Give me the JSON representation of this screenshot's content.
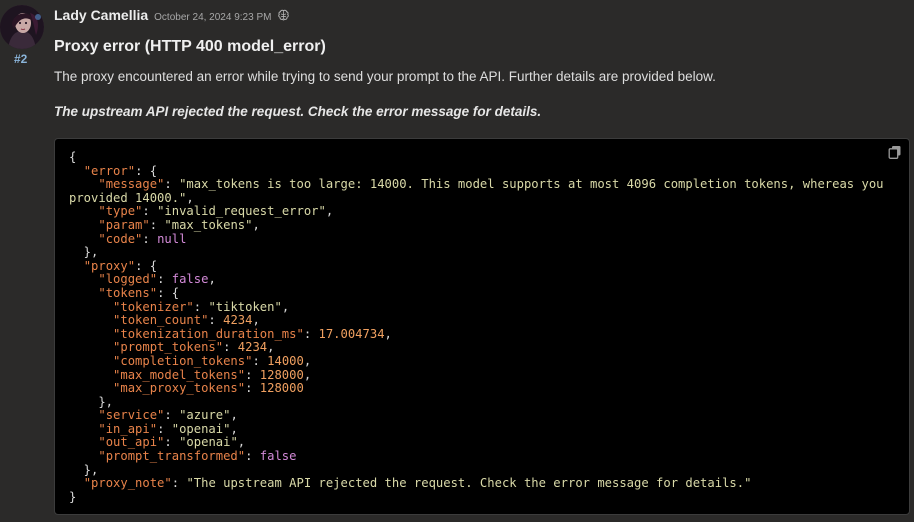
{
  "message": {
    "author": "Lady Camellia",
    "timestamp": "October 24, 2024 9:23 PM",
    "index": "#2",
    "title": "Proxy error (HTTP 400 model_error)",
    "description": "The proxy encountered an error while trying to send your prompt to the API. Further details are provided below.",
    "note": "The upstream API rejected the request. Check the error message for details."
  },
  "icons": {
    "avatar": "avatar-image",
    "brain": "brain-icon",
    "copy": "copy-icon"
  },
  "code": {
    "lines": [
      [
        [
          "p",
          "{"
        ]
      ],
      [
        [
          "p",
          "  "
        ],
        [
          "k",
          "\"error\""
        ],
        [
          "p",
          ": {"
        ]
      ],
      [
        [
          "p",
          "    "
        ],
        [
          "k",
          "\"message\""
        ],
        [
          "p",
          ": "
        ],
        [
          "s",
          "\"max_tokens is too large: 14000. This model supports at most 4096 completion tokens, whereas you"
        ]
      ],
      [
        [
          "s",
          "provided 14000.\""
        ],
        [
          "p",
          ","
        ]
      ],
      [
        [
          "p",
          "    "
        ],
        [
          "k",
          "\"type\""
        ],
        [
          "p",
          ": "
        ],
        [
          "s",
          "\"invalid_request_error\""
        ],
        [
          "p",
          ","
        ]
      ],
      [
        [
          "p",
          "    "
        ],
        [
          "k",
          "\"param\""
        ],
        [
          "p",
          ": "
        ],
        [
          "s",
          "\"max_tokens\""
        ],
        [
          "p",
          ","
        ]
      ],
      [
        [
          "p",
          "    "
        ],
        [
          "k",
          "\"code\""
        ],
        [
          "p",
          ": "
        ],
        [
          "b",
          "null"
        ]
      ],
      [
        [
          "p",
          "  },"
        ]
      ],
      [
        [
          "p",
          "  "
        ],
        [
          "k",
          "\"proxy\""
        ],
        [
          "p",
          ": {"
        ]
      ],
      [
        [
          "p",
          "    "
        ],
        [
          "k",
          "\"logged\""
        ],
        [
          "p",
          ": "
        ],
        [
          "b",
          "false"
        ],
        [
          "p",
          ","
        ]
      ],
      [
        [
          "p",
          "    "
        ],
        [
          "k",
          "\"tokens\""
        ],
        [
          "p",
          ": {"
        ]
      ],
      [
        [
          "p",
          "      "
        ],
        [
          "k",
          "\"tokenizer\""
        ],
        [
          "p",
          ": "
        ],
        [
          "s",
          "\"tiktoken\""
        ],
        [
          "p",
          ","
        ]
      ],
      [
        [
          "p",
          "      "
        ],
        [
          "k",
          "\"token_count\""
        ],
        [
          "p",
          ": "
        ],
        [
          "n",
          "4234"
        ],
        [
          "p",
          ","
        ]
      ],
      [
        [
          "p",
          "      "
        ],
        [
          "k",
          "\"tokenization_duration_ms\""
        ],
        [
          "p",
          ": "
        ],
        [
          "n",
          "17.004734"
        ],
        [
          "p",
          ","
        ]
      ],
      [
        [
          "p",
          "      "
        ],
        [
          "k",
          "\"prompt_tokens\""
        ],
        [
          "p",
          ": "
        ],
        [
          "n",
          "4234"
        ],
        [
          "p",
          ","
        ]
      ],
      [
        [
          "p",
          "      "
        ],
        [
          "k",
          "\"completion_tokens\""
        ],
        [
          "p",
          ": "
        ],
        [
          "n",
          "14000"
        ],
        [
          "p",
          ","
        ]
      ],
      [
        [
          "p",
          "      "
        ],
        [
          "k",
          "\"max_model_tokens\""
        ],
        [
          "p",
          ": "
        ],
        [
          "n",
          "128000"
        ],
        [
          "p",
          ","
        ]
      ],
      [
        [
          "p",
          "      "
        ],
        [
          "k",
          "\"max_proxy_tokens\""
        ],
        [
          "p",
          ": "
        ],
        [
          "n",
          "128000"
        ]
      ],
      [
        [
          "p",
          "    },"
        ]
      ],
      [
        [
          "p",
          "    "
        ],
        [
          "k",
          "\"service\""
        ],
        [
          "p",
          ": "
        ],
        [
          "s",
          "\"azure\""
        ],
        [
          "p",
          ","
        ]
      ],
      [
        [
          "p",
          "    "
        ],
        [
          "k",
          "\"in_api\""
        ],
        [
          "p",
          ": "
        ],
        [
          "s",
          "\"openai\""
        ],
        [
          "p",
          ","
        ]
      ],
      [
        [
          "p",
          "    "
        ],
        [
          "k",
          "\"out_api\""
        ],
        [
          "p",
          ": "
        ],
        [
          "s",
          "\"openai\""
        ],
        [
          "p",
          ","
        ]
      ],
      [
        [
          "p",
          "    "
        ],
        [
          "k",
          "\"prompt_transformed\""
        ],
        [
          "p",
          ": "
        ],
        [
          "b",
          "false"
        ]
      ],
      [
        [
          "p",
          "  },"
        ]
      ],
      [
        [
          "p",
          "  "
        ],
        [
          "k",
          "\"proxy_note\""
        ],
        [
          "p",
          ": "
        ],
        [
          "s",
          "\"The upstream API rejected the request. Check the error message for details.\""
        ]
      ],
      [
        [
          "p",
          "}"
        ]
      ]
    ]
  },
  "colors": {
    "background": "#2b2a29",
    "code_background": "#000000",
    "json_key": "#e8834a",
    "json_string": "#d9d9a8",
    "json_number": "#f0a060",
    "json_literal": "#d38ad8",
    "index_link": "#8ab4d9"
  }
}
